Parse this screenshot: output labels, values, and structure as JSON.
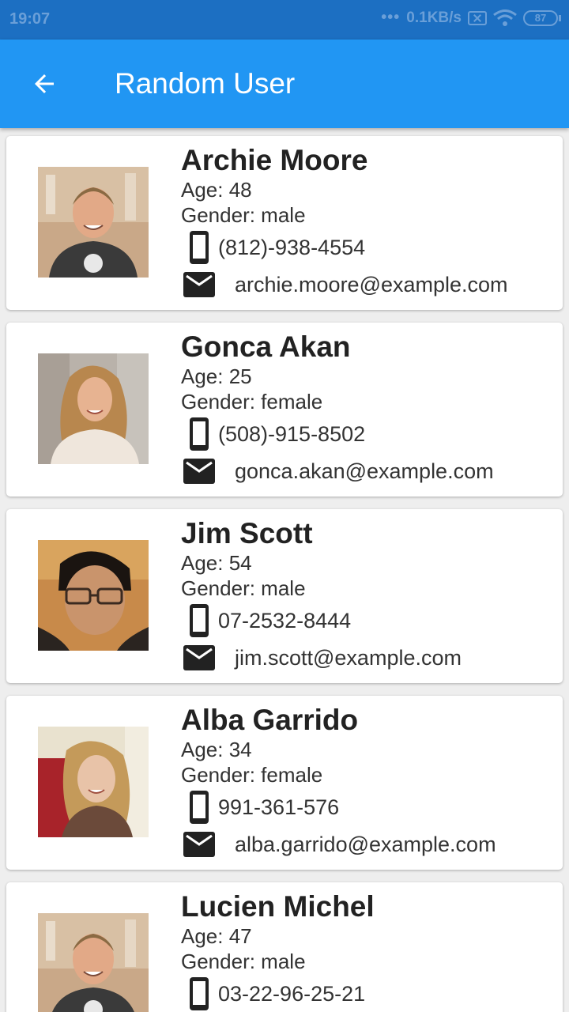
{
  "status_bar": {
    "time": "19:07",
    "dots": "•••",
    "network_speed": "0.1KB/s",
    "battery": "87"
  },
  "app_bar": {
    "title": "Random User",
    "back_icon": "arrow-back-icon"
  },
  "colors": {
    "app_bar": "#2196f3",
    "status_bar": "#1c6fc2",
    "background": "#eeeeee"
  },
  "users": [
    {
      "name": "Archie Moore",
      "age": "Age: 48",
      "gender": "Gender: male",
      "phone": "(812)-938-4554",
      "email": "archie.moore@example.com"
    },
    {
      "name": "Gonca Akan",
      "age": "Age: 25",
      "gender": "Gender: female",
      "phone": "(508)-915-8502",
      "email": "gonca.akan@example.com"
    },
    {
      "name": "Jim Scott",
      "age": "Age: 54",
      "gender": "Gender: male",
      "phone": "07-2532-8444",
      "email": "jim.scott@example.com"
    },
    {
      "name": "Alba Garrido",
      "age": "Age: 34",
      "gender": "Gender: female",
      "phone": "991-361-576",
      "email": "alba.garrido@example.com"
    },
    {
      "name": "Lucien Michel",
      "age": "Age: 47",
      "gender": "Gender: male",
      "phone": "03-22-96-25-21",
      "email": ""
    }
  ]
}
